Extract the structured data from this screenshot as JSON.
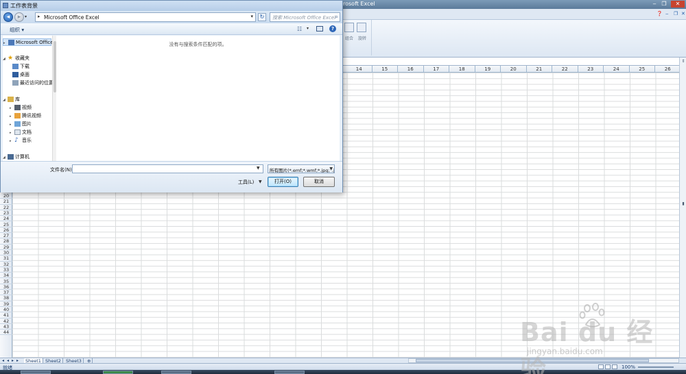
{
  "excel": {
    "title": "rosoft Excel",
    "columns": [
      "14",
      "15",
      "16",
      "17",
      "18",
      "19",
      "20",
      "21",
      "22",
      "23",
      "24",
      "25",
      "26"
    ],
    "rows": [
      "20",
      "21",
      "22",
      "23",
      "24",
      "25",
      "26",
      "27",
      "28",
      "29",
      "30",
      "31",
      "32",
      "33",
      "34",
      "35",
      "36",
      "37",
      "38",
      "39",
      "40",
      "41",
      "42",
      "43",
      "44"
    ],
    "ribbon_labels": [
      "组合",
      "旋转"
    ],
    "sheets": [
      "Sheet1",
      "Sheet2",
      "Sheet3"
    ],
    "status": "就绪",
    "zoom": "100%"
  },
  "dialog": {
    "title": "工作表背景",
    "path": "Microsoft Office Excel",
    "search_placeholder": "搜索 Microsoft Office Excel",
    "organize": "组织 ▾",
    "empty_message": "没有与搜索条件匹配的项。",
    "nav": {
      "root": "Microsoft Office",
      "favorites": "收藏夹",
      "downloads": "下载",
      "desktop": "桌面",
      "recent": "最近访问的位置",
      "libraries": "库",
      "videos": "视频",
      "tencent_video": "腾讯视频",
      "pictures": "图片",
      "documents": "文档",
      "music": "音乐",
      "computer": "计算机"
    },
    "filename_label": "文件名(N):",
    "filename_value": "",
    "filter": "所有图片(*.emf;*.wmf;*.jpg;*.j",
    "tools": "工具(L)",
    "open": "打开(O)",
    "cancel": "取消"
  },
  "watermark": {
    "logo": "Bai  du 经验",
    "url": "jingyan.baidu.com"
  },
  "colors": {
    "accent": "#1e5aa8",
    "dialog_bg": "#e8f0f9",
    "grid_line": "#dadcdd"
  }
}
